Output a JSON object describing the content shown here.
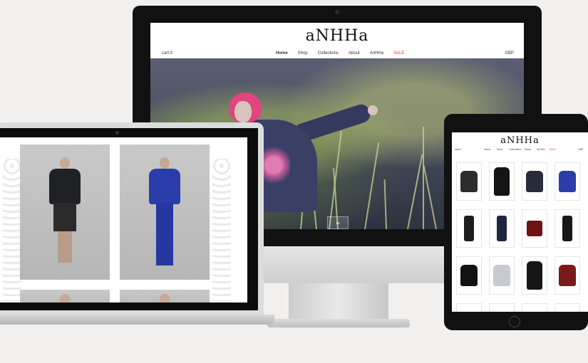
{
  "desktop": {
    "logo": "aNHHa",
    "cart": "cart:0",
    "currency": "GBP",
    "nav": [
      {
        "label": "Home",
        "state": "active"
      },
      {
        "label": "Shop",
        "state": ""
      },
      {
        "label": "Collections",
        "state": ""
      },
      {
        "label": "About",
        "state": ""
      },
      {
        "label": "AnHHa",
        "state": ""
      },
      {
        "label": "SALE",
        "state": "sale"
      }
    ],
    "hero_arrow": "⌄"
  },
  "tablet": {
    "logo": "aNHHa",
    "cart": "cart:0",
    "currency": "GBP",
    "nav": [
      "Home",
      "Shop",
      "Collections",
      "About",
      "AnHHa",
      "SALE"
    ]
  },
  "colors": {
    "sale": "#e23b3b",
    "hair": "#e0457f",
    "garment_navy": "#272b3a",
    "garment_blue": "#2a3da8",
    "garment_black": "#151515",
    "garment_red": "#7b1a1a"
  },
  "products": [
    {
      "kind": "top",
      "color": "#2c2c2c"
    },
    {
      "kind": "dress",
      "color": "#151515"
    },
    {
      "kind": "top",
      "color": "#272b3a"
    },
    {
      "kind": "top",
      "color": "#2a3da8"
    },
    {
      "kind": "pants",
      "color": "#1d1d1d"
    },
    {
      "kind": "jumpsuit",
      "color": "#1f2540"
    },
    {
      "kind": "skirt",
      "color": "#6e1414"
    },
    {
      "kind": "pants",
      "color": "#181818"
    },
    {
      "kind": "top",
      "color": "#121212"
    },
    {
      "kind": "top",
      "color": "#c9c9d3"
    },
    {
      "kind": "dress",
      "color": "#161616"
    },
    {
      "kind": "top",
      "color": "#7b1a1a"
    }
  ]
}
